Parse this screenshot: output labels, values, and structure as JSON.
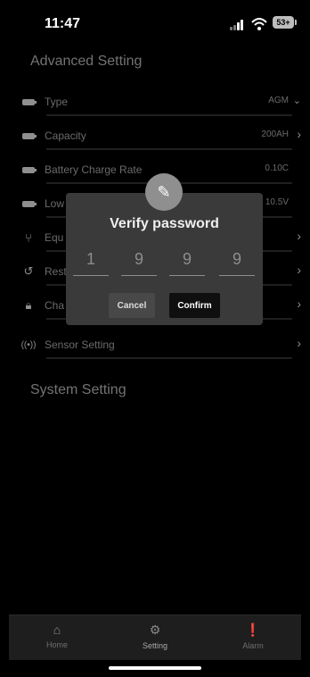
{
  "status": {
    "time": "11:47",
    "battery": "53+"
  },
  "advanced": {
    "title": "Advanced Setting",
    "rows": [
      {
        "icon": "battery-icon",
        "label": "Type",
        "value": "AGM"
      },
      {
        "icon": "battery-icon",
        "label": "Capacity",
        "value": "200AH"
      },
      {
        "icon": "battery-icon",
        "label": "Battery Charge Rate",
        "value": "0.10C"
      },
      {
        "icon": "battery-icon",
        "label": "Low",
        "value": "10.5V"
      },
      {
        "icon": "fork-icon",
        "label": "Equ",
        "value": ""
      },
      {
        "icon": "restore-icon",
        "label": "Rest",
        "value": ""
      },
      {
        "icon": "lock-icon",
        "label": "Cha",
        "value": ""
      },
      {
        "icon": "sensor-icon",
        "label": "Sensor Setting",
        "value": ""
      }
    ]
  },
  "system": {
    "title": "System Setting"
  },
  "modal": {
    "title": "Verify password",
    "digits": [
      "1",
      "9",
      "9",
      "9"
    ],
    "cancel": "Cancel",
    "confirm": "Confirm"
  },
  "nav": {
    "items": [
      {
        "label": "Home",
        "icon": "home-icon"
      },
      {
        "label": "Setting",
        "icon": "gear-icon"
      },
      {
        "label": "Alarm",
        "icon": "alarm-icon"
      }
    ]
  },
  "colors": {
    "background": "#000000",
    "modal": "#3a3a3a",
    "confirm_button": "#0f0f0f"
  }
}
